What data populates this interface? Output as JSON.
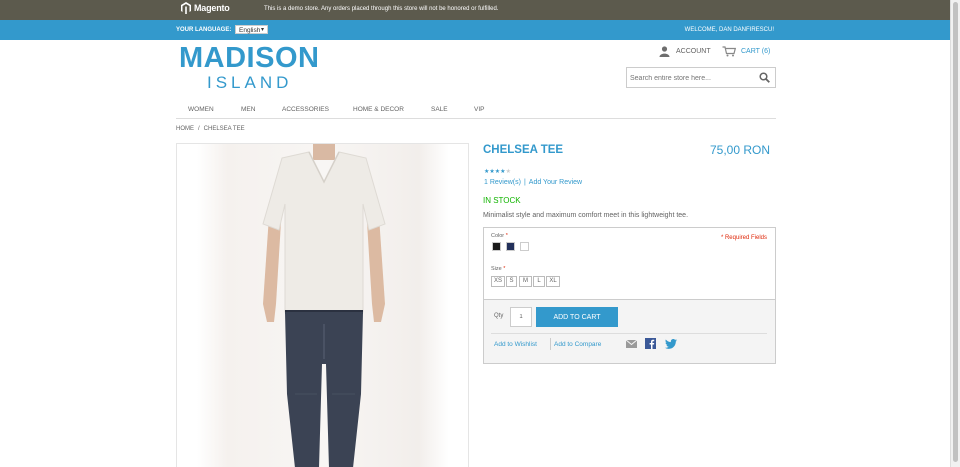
{
  "demo_bar": {
    "brand": "Magento",
    "notice": "This is a demo store. Any orders placed through this store will not be honored or fulfilled."
  },
  "language_bar": {
    "label": "YOUR LANGUAGE:",
    "selected_language": "English",
    "welcome": "WELCOME, DAN DANFIRESCU!"
  },
  "logo": {
    "line1": "MADISON",
    "line2": "ISLAND"
  },
  "header": {
    "account": "ACCOUNT",
    "cart": "CART (6)",
    "search_placeholder": "Search entire store here..."
  },
  "nav": [
    "WOMEN",
    "MEN",
    "ACCESSORIES",
    "HOME & DECOR",
    "SALE",
    "VIP"
  ],
  "breadcrumb": {
    "home": "HOME",
    "separator": "/",
    "current": "CHELSEA TEE"
  },
  "product": {
    "name": "CHELSEA TEE",
    "price": "75,00 RON",
    "rating": 4,
    "rating_max": 5,
    "reviews_link": "1 Review(s)",
    "review_separator": "|",
    "add_review_link": "Add Your Review",
    "stock": "IN STOCK",
    "description": "Minimalist style and maximum comfort meet in this lightweight tee."
  },
  "options": {
    "required_note": "* Required Fields",
    "color_label": "Color",
    "color_swatches": [
      "#1a1a1a",
      "#22305a",
      "#ffffff"
    ],
    "size_label": "Size",
    "required_marker": "*",
    "sizes": [
      "XS",
      "S",
      "M",
      "L",
      "XL"
    ]
  },
  "add_to_cart": {
    "qty_label": "Qty",
    "qty_value": "1",
    "button": "ADD TO CART",
    "wishlist_link": "Add to Wishlist",
    "compare_link": "Add to Compare"
  },
  "colors": {
    "accent": "#3399cc",
    "demo_bar": "#5c5a4d",
    "in_stock": "#11b400",
    "required": "#df280a"
  }
}
